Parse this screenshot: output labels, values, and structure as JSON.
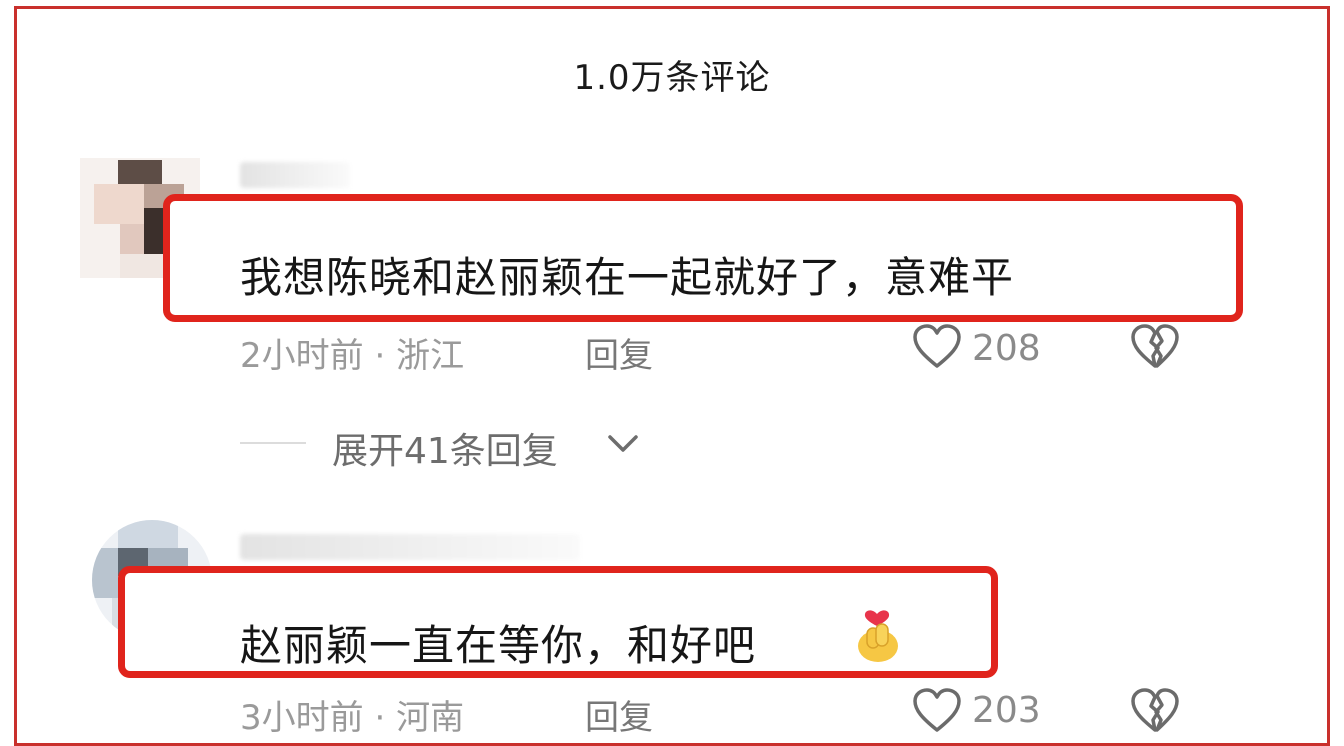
{
  "header": {
    "title": "1.0万条评论"
  },
  "comments": [
    {
      "text": "我想陈晓和赵丽颖在一起就好了，意难平",
      "time": "2小时前",
      "location": "浙江",
      "reply_label": "回复",
      "likes": "208",
      "expand_label": "展开41条回复",
      "icons": {
        "like": "heart-outline-icon",
        "dislike": "broken-heart-icon",
        "expand": "chevron-down-icon"
      }
    },
    {
      "text": "赵丽颖一直在等你，和好吧",
      "emoji": "finger-heart-emoji",
      "time": "3小时前",
      "location": "河南",
      "reply_label": "回复",
      "likes": "203",
      "icons": {
        "like": "heart-outline-icon",
        "dislike": "broken-heart-icon"
      }
    }
  ],
  "colors": {
    "highlight": "#e0241c",
    "frame": "#c9302c"
  }
}
